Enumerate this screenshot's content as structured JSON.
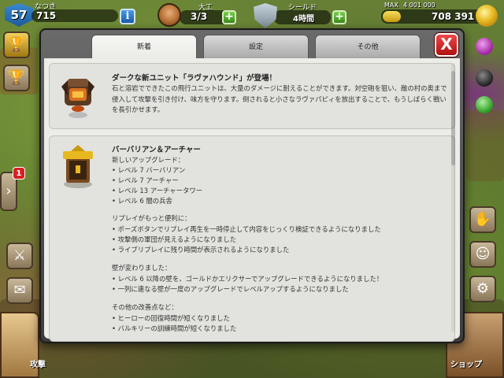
{
  "hud": {
    "player_level": "57",
    "player_name": "なつき",
    "xp_value": "715",
    "info_icon": "info-icon",
    "builder_label": "大工",
    "builder_value": "3/3",
    "plus_label": "+",
    "shield_label": "シールド",
    "shield_value": "4時間",
    "gold_max_label": "MAX",
    "gold_max_value": "4 001 000",
    "gold_value": "708 391",
    "gold_fill_fraction": 0.18
  },
  "side": {
    "notification_count": "1",
    "attack_label": "攻撃",
    "shop_label": "ショップ",
    "left_icons": [
      "trophy-icon",
      "league-icon",
      "expand-arrow-icon",
      "swords-icon",
      "mail-icon"
    ],
    "right_icons": [
      "elixir-drop-icon",
      "dark-elixir-icon",
      "gem-icon",
      "social-icon",
      "clan-icon",
      "settings-icon"
    ]
  },
  "dialog": {
    "tabs": [
      {
        "label": "新着",
        "active": true
      },
      {
        "label": "設定",
        "active": false
      },
      {
        "label": "その他",
        "active": false
      }
    ],
    "close_label": "X",
    "cards": [
      {
        "title": "ダークな新ユニット「ラヴァハウンド」が登場！",
        "body": "石と溶岩でできたこの飛行ユニットは、大量のダメージに耐えることができます。対空砲を狙い、敵の村の奥まで侵入して攻撃を引き付け、味方を守ります。倒されると小さなラヴァパピィを放出することで、もうしばらく戦いを長引かせます。"
      },
      {
        "title": "バーバリアン＆アーチャー",
        "lines": [
          "新しいアップグレード：",
          "• レベル 7 バーバリアン",
          "• レベル 7 アーチャー",
          "• レベル 13 アーチャータワー",
          "• レベル 6 闇の兵舎",
          "",
          "リプレイがもっと便利に：",
          "• ポーズボタンでリプレイ再生を一時停止して内容をじっくり検証できるようになりました",
          "• 攻撃側の軍団が見えるようになりました",
          "• ライブリプレイに残り時間が表示されるようになりました",
          "",
          "壁が変わりました：",
          "• レベル 6 以降の壁を、ゴールドかエリクサーでアップグレードできるようになりました！",
          "• 一列に連なる壁が一度のアップグレードでレベルアップするようになりました",
          "",
          "その他の改善点など：",
          "• ヒーローの回復時間が短くなりました",
          "• バルキリーの訓練時間が短くなりました"
        ]
      }
    ]
  },
  "colors": {
    "close_red": "#d82020",
    "tab_active": "#f6f6f4",
    "content_bg": "#ecece8",
    "plus_green": "#5ab02a"
  }
}
